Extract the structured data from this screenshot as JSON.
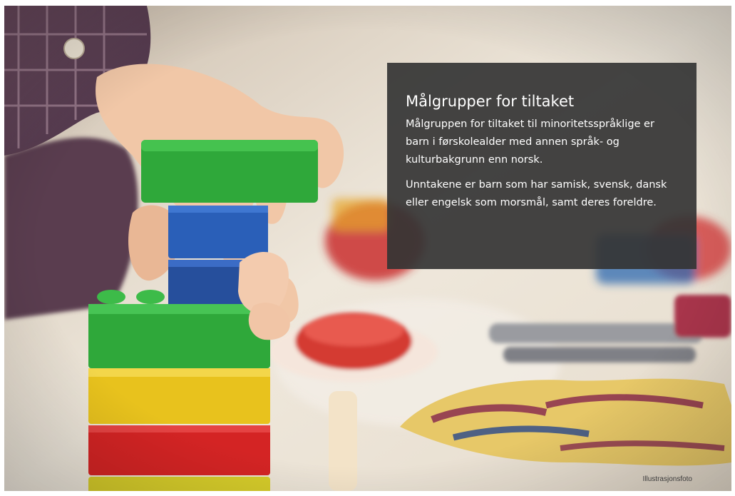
{
  "slide": {
    "title": "Målgrupper for tiltaket",
    "paragraphs": [
      "Målgruppen for tiltaket til minoritetsspråklige er barn i førskolealder med annen språk- og kulturbakgrunn enn norsk.",
      "Unntakene er barn som har samisk, svensk, dansk eller engelsk som morsmål, samt deres foreldre."
    ],
    "photo_caption": "Illustrasjonsfoto"
  },
  "photo": {
    "subject": "child's hand stacking colorful toy building blocks",
    "block_colors": [
      "#2fa83a",
      "#2a5fb8",
      "#2a5fb8",
      "#2fa83a",
      "#e8c21d",
      "#d42424",
      "#d6cc2a"
    ],
    "background_tone": "#e9e2d6"
  },
  "colors": {
    "panel": "#343434",
    "panel_text": "#ffffff",
    "caption_text": "#3a3a3a"
  }
}
